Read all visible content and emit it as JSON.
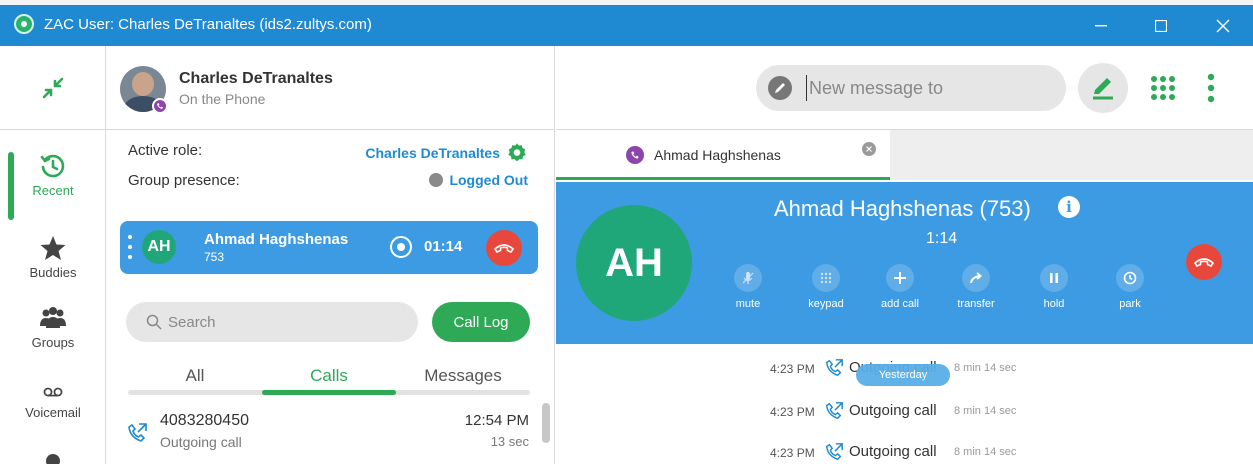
{
  "window": {
    "title": "ZAC User: Charles DeTranaltes (ids2.zultys.com)"
  },
  "nav": {
    "items": [
      {
        "label": "Recent",
        "icon": "history-icon"
      },
      {
        "label": "Buddies",
        "icon": "star-icon"
      },
      {
        "label": "Groups",
        "icon": "group-icon"
      },
      {
        "label": "Voicemail",
        "icon": "voicemail-icon"
      }
    ]
  },
  "user": {
    "name": "Charles DeTranaltes",
    "status": "On the Phone"
  },
  "role": {
    "active_label": "Active role:",
    "active_value": "Charles DeTranaltes",
    "group_label": "Group presence:",
    "group_value": "Logged Out"
  },
  "active_call": {
    "initials": "AH",
    "name": "Ahmad Haghshenas",
    "ext": "753",
    "timer": "01:14"
  },
  "search": {
    "placeholder": "Search"
  },
  "call_log_button": "Call Log",
  "filter_tabs": [
    "All",
    "Calls",
    "Messages"
  ],
  "history": [
    {
      "number": "4083280450",
      "kind": "Outgoing call",
      "time": "12:54 PM",
      "duration": "13 sec"
    }
  ],
  "message": {
    "placeholder": "New message to"
  },
  "conversation_tab": {
    "label": "Ahmad Haghshenas"
  },
  "call_panel": {
    "initials": "AH",
    "title": "Ahmad Haghshenas (753)",
    "info": "i",
    "timer": "1:14",
    "controls": [
      "mute",
      "keypad",
      "add call",
      "transfer",
      "hold",
      "park"
    ]
  },
  "log": {
    "divider": "Yesterday",
    "entries": [
      {
        "time": "4:23 PM",
        "kind": "Outgoing call",
        "duration": "8 min 14 sec"
      },
      {
        "time": "4:23 PM",
        "kind": "Outgoing call",
        "duration": "8 min 14 sec"
      },
      {
        "time": "4:23 PM",
        "kind": "Outgoing call",
        "duration": "8 min 14 sec"
      }
    ]
  },
  "colors": {
    "titlebar": "#1f8ad2",
    "call_blue": "#3d9be3",
    "accent_green": "#2eaa57",
    "hangup_red": "#e8473c",
    "avatar_green": "#1fa77a"
  }
}
